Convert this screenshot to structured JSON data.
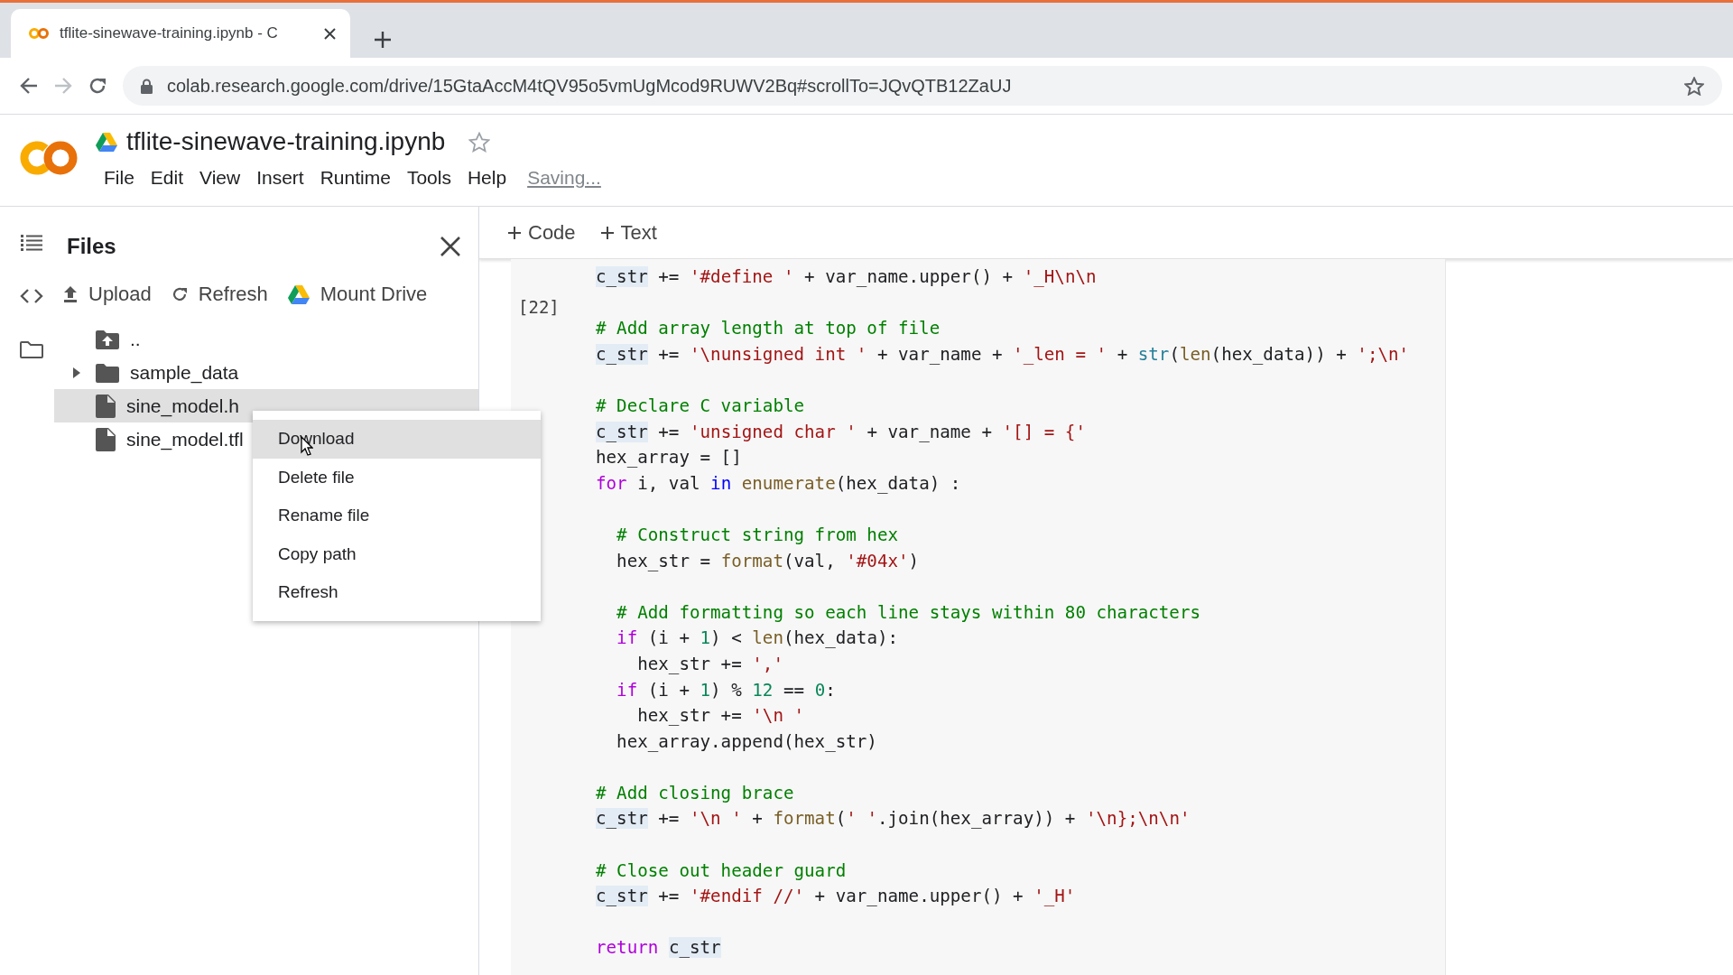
{
  "browser": {
    "tab": {
      "title": "tflite-sinewave-training.ipynb - C",
      "selected": true
    },
    "address": "colab.research.google.com/drive/15GtaAccM4tQV95o5vmUgMcod9RUWV2Bq#scrollTo=JQvQTB12ZaUJ"
  },
  "notebook": {
    "title": "tflite-sinewave-training.ipynb",
    "menu": [
      "File",
      "Edit",
      "View",
      "Insert",
      "Runtime",
      "Tools",
      "Help"
    ],
    "status": "Saving..."
  },
  "sidebar": {
    "title": "Files",
    "actions": [
      {
        "kind": "upload",
        "label": "Upload"
      },
      {
        "kind": "refresh",
        "label": "Refresh"
      },
      {
        "kind": "drive",
        "label": "Mount Drive"
      }
    ],
    "tree": [
      {
        "kind": "parent",
        "name": "..",
        "selected": false
      },
      {
        "kind": "folder",
        "name": "sample_data",
        "expanded": false,
        "selected": false
      },
      {
        "kind": "file",
        "name": "sine_model.h",
        "selected": true
      },
      {
        "kind": "file",
        "name": "sine_model.tfl",
        "selected": false
      }
    ]
  },
  "context_menu": [
    {
      "label": "Download",
      "selected": true
    },
    {
      "label": "Delete file",
      "selected": false
    },
    {
      "label": "Rename file",
      "selected": false
    },
    {
      "label": "Copy path",
      "selected": false
    },
    {
      "label": "Refresh",
      "selected": false
    }
  ],
  "toolbar": [
    {
      "kind": "add",
      "label": "Code"
    },
    {
      "kind": "add",
      "label": "Text"
    }
  ],
  "cell": {
    "prompt": "[22]",
    "lines": [
      {
        "kind": "code",
        "tokens": [
          {
            "kind": "var",
            "text": "c_str"
          },
          {
            "kind": "plain",
            "text": " += "
          },
          {
            "kind": "string",
            "text": "'#define '"
          },
          {
            "kind": "plain",
            "text": " + var_name.upper() + "
          },
          {
            "kind": "string",
            "text": "'_H\\n\\n"
          }
        ]
      },
      {
        "kind": "blank"
      },
      {
        "kind": "code",
        "tokens": [
          {
            "kind": "comment",
            "text": "# Add array length at top of file"
          }
        ]
      },
      {
        "kind": "code",
        "tokens": [
          {
            "kind": "var",
            "text": "c_str"
          },
          {
            "kind": "plain",
            "text": " += "
          },
          {
            "kind": "string",
            "text": "'\\nunsigned int '"
          },
          {
            "kind": "plain",
            "text": " + var_name + "
          },
          {
            "kind": "string",
            "text": "'_len = '"
          },
          {
            "kind": "plain",
            "text": " + "
          },
          {
            "kind": "type",
            "text": "str"
          },
          {
            "kind": "plain",
            "text": "("
          },
          {
            "kind": "function",
            "text": "len"
          },
          {
            "kind": "plain",
            "text": "(hex_data)) + "
          },
          {
            "kind": "string",
            "text": "';\\n'"
          }
        ]
      },
      {
        "kind": "blank"
      },
      {
        "kind": "code",
        "tokens": [
          {
            "kind": "comment",
            "text": "# Declare C variable"
          }
        ]
      },
      {
        "kind": "code",
        "tokens": [
          {
            "kind": "var",
            "text": "c_str"
          },
          {
            "kind": "plain",
            "text": " += "
          },
          {
            "kind": "string",
            "text": "'unsigned char '"
          },
          {
            "kind": "plain",
            "text": " + var_name + "
          },
          {
            "kind": "string",
            "text": "'[] = {'"
          }
        ]
      },
      {
        "kind": "code",
        "tokens": [
          {
            "kind": "plain",
            "text": "hex_array = []"
          }
        ]
      },
      {
        "kind": "code",
        "tokens": [
          {
            "kind": "keyword",
            "text": "for"
          },
          {
            "kind": "plain",
            "text": " i, val "
          },
          {
            "kind": "operator",
            "text": "in"
          },
          {
            "kind": "function",
            "text": " enumerate"
          },
          {
            "kind": "plain",
            "text": "(hex_data) :"
          }
        ]
      },
      {
        "kind": "blank"
      },
      {
        "kind": "code",
        "tokens": [
          {
            "kind": "comment",
            "text": "  # Construct string from hex"
          }
        ]
      },
      {
        "kind": "code",
        "tokens": [
          {
            "kind": "plain",
            "text": "  hex_str = "
          },
          {
            "kind": "function",
            "text": "format"
          },
          {
            "kind": "plain",
            "text": "(val, "
          },
          {
            "kind": "string",
            "text": "'#04x'"
          },
          {
            "kind": "plain",
            "text": ")"
          }
        ]
      },
      {
        "kind": "blank"
      },
      {
        "kind": "code",
        "tokens": [
          {
            "kind": "comment",
            "text": "  # Add formatting so each line stays within 80 characters"
          }
        ]
      },
      {
        "kind": "code",
        "tokens": [
          {
            "kind": "keyword",
            "text": "  if"
          },
          {
            "kind": "plain",
            "text": " (i + "
          },
          {
            "kind": "number",
            "text": "1"
          },
          {
            "kind": "plain",
            "text": ") < "
          },
          {
            "kind": "function",
            "text": "len"
          },
          {
            "kind": "plain",
            "text": "(hex_data):"
          }
        ]
      },
      {
        "kind": "code",
        "tokens": [
          {
            "kind": "plain",
            "text": "    hex_str += "
          },
          {
            "kind": "string",
            "text": "','"
          }
        ]
      },
      {
        "kind": "code",
        "tokens": [
          {
            "kind": "keyword",
            "text": "  if"
          },
          {
            "kind": "plain",
            "text": " (i + "
          },
          {
            "kind": "number",
            "text": "1"
          },
          {
            "kind": "plain",
            "text": ") % "
          },
          {
            "kind": "number",
            "text": "12"
          },
          {
            "kind": "plain",
            "text": " == "
          },
          {
            "kind": "number",
            "text": "0"
          },
          {
            "kind": "plain",
            "text": ":"
          }
        ]
      },
      {
        "kind": "code",
        "tokens": [
          {
            "kind": "plain",
            "text": "    hex_str += "
          },
          {
            "kind": "string",
            "text": "'\\n '"
          }
        ]
      },
      {
        "kind": "code",
        "tokens": [
          {
            "kind": "plain",
            "text": "  hex_array.append(hex_str)"
          }
        ]
      },
      {
        "kind": "blank"
      },
      {
        "kind": "code",
        "tokens": [
          {
            "kind": "comment",
            "text": "# Add closing brace"
          }
        ]
      },
      {
        "kind": "code",
        "tokens": [
          {
            "kind": "var",
            "text": "c_str"
          },
          {
            "kind": "plain",
            "text": " += "
          },
          {
            "kind": "string",
            "text": "'\\n '"
          },
          {
            "kind": "plain",
            "text": " + "
          },
          {
            "kind": "function",
            "text": "format"
          },
          {
            "kind": "plain",
            "text": "("
          },
          {
            "kind": "string",
            "text": "' '"
          },
          {
            "kind": "plain",
            "text": ".join(hex_array)) + "
          },
          {
            "kind": "string",
            "text": "'\\n};\\n\\n'"
          }
        ]
      },
      {
        "kind": "blank"
      },
      {
        "kind": "code",
        "tokens": [
          {
            "kind": "comment",
            "text": "# Close out header guard"
          }
        ]
      },
      {
        "kind": "code",
        "tokens": [
          {
            "kind": "var",
            "text": "c_str"
          },
          {
            "kind": "plain",
            "text": " += "
          },
          {
            "kind": "string",
            "text": "'#endif //'"
          },
          {
            "kind": "plain",
            "text": " + var_name.upper() + "
          },
          {
            "kind": "string",
            "text": "'_H'"
          }
        ]
      },
      {
        "kind": "blank"
      },
      {
        "kind": "code",
        "tokens": [
          {
            "kind": "keyword",
            "text": "return "
          },
          {
            "kind": "var",
            "text": "c_str"
          }
        ]
      }
    ]
  }
}
